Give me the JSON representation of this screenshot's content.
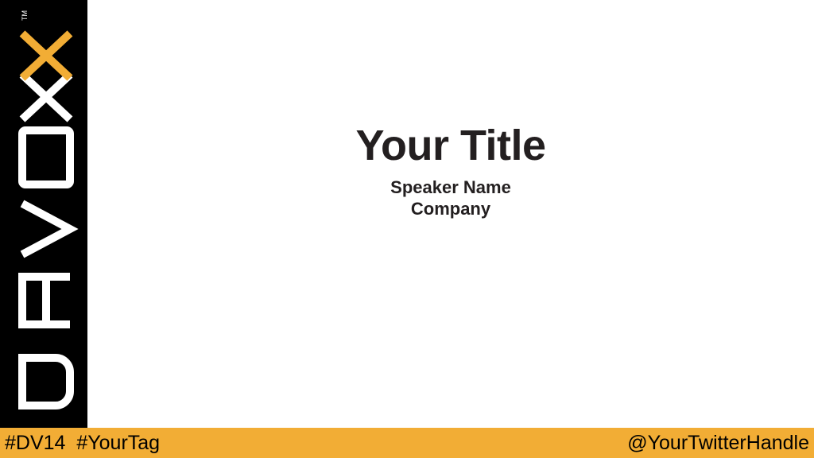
{
  "brand": {
    "logo_text": "DEVOXX",
    "trademark": "TM",
    "accent_color": "#f2ad35"
  },
  "slide": {
    "title": "Your Title",
    "speaker": "Speaker Name",
    "company": "Company"
  },
  "footer": {
    "event_tag": "#DV14",
    "custom_tag": "#YourTag",
    "twitter_handle": "@YourTwitterHandle",
    "background_color": "#f2ad35"
  }
}
